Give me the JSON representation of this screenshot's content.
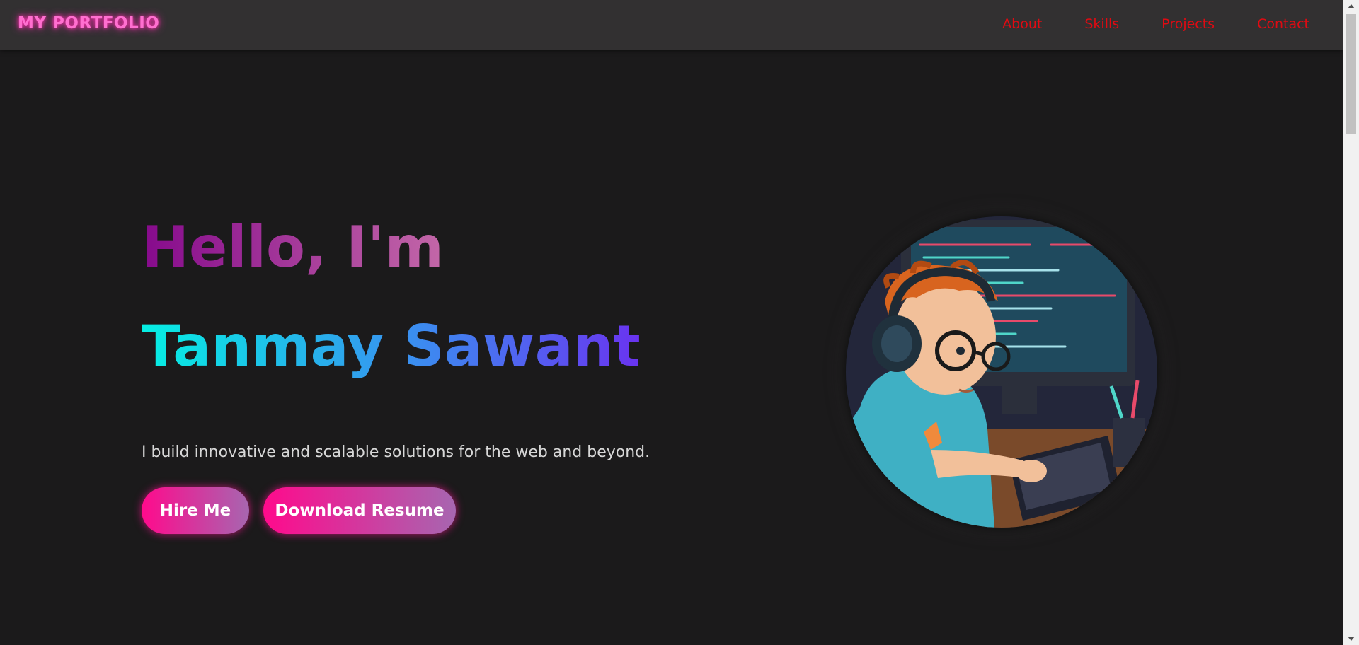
{
  "navbar": {
    "logo": "MY PORTFOLIO",
    "links": [
      "About",
      "Skills",
      "Projects",
      "Contact"
    ]
  },
  "hero": {
    "greeting": "Hello, I'm",
    "name": "Tanmay Sawant",
    "tagline": "I build innovative and scalable solutions for the web and beyond.",
    "buttons": {
      "hire": "Hire Me",
      "resume": "Download Resume"
    }
  },
  "colors": {
    "background": "#1b1a1b",
    "navbar": "#323031",
    "nav_link": "#e00a12",
    "logo": "#ff6fd0",
    "button_gradient_start": "#ff0a8c",
    "button_gradient_end": "#a766b0"
  },
  "icons": {
    "avatar": "coder-avatar-illustration"
  }
}
